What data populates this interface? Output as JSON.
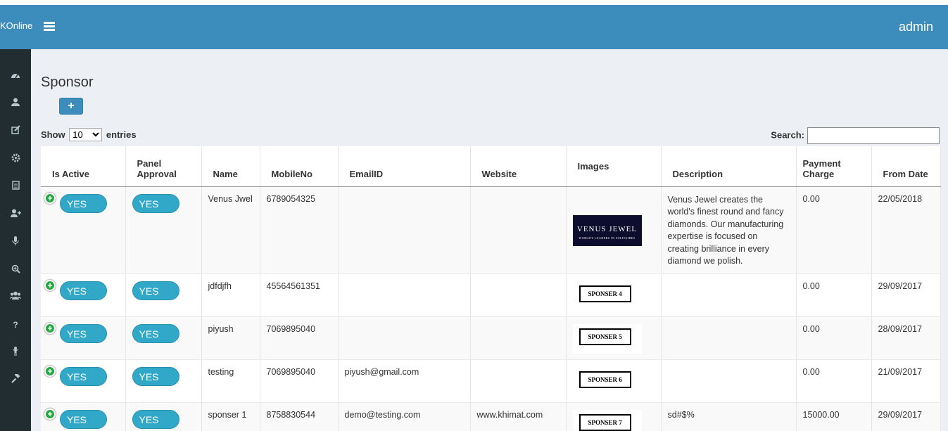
{
  "app": {
    "brand": "KOnline",
    "user": "admin"
  },
  "page": {
    "title": "Sponsor",
    "add_label": "+"
  },
  "table_controls": {
    "show_label": "Show",
    "entries_value": "10",
    "entries_label": "entries",
    "search_label": "Search:"
  },
  "columns": [
    "Is Active",
    "Panel Approval",
    "Name",
    "MobileNo",
    "EmailID",
    "Website",
    "Images",
    "Description",
    "Payment Charge",
    "From Date"
  ],
  "rows": [
    {
      "active": "YES",
      "approval": "YES",
      "name": "Venus Jwel",
      "mobile": "6789054325",
      "email": "",
      "website": "",
      "image": "VENUS JEWEL",
      "image_sub": "WORLD'S LEADERS IN SOLITAIRES",
      "description": "Venus Jewel creates the world's finest round and fancy diamonds. Our manufacturing expertise is focused on creating brilliance in every diamond we polish.",
      "payment": "0.00",
      "from": "22/05/2018"
    },
    {
      "active": "YES",
      "approval": "YES",
      "name": "jdfdjfh",
      "mobile": "45564561351",
      "email": "",
      "website": "",
      "image": "SPONSER 4",
      "description": "",
      "payment": "0.00",
      "from": "29/09/2017"
    },
    {
      "active": "YES",
      "approval": "YES",
      "name": "piyush",
      "mobile": "7069895040",
      "email": "",
      "website": "",
      "image": "SPONSER 5",
      "description": "",
      "payment": "0.00",
      "from": "28/09/2017"
    },
    {
      "active": "YES",
      "approval": "YES",
      "name": "testing",
      "mobile": "7069895040",
      "email": "piyush@gmail.com",
      "website": "",
      "image": "SPONSER 6",
      "description": "",
      "payment": "0.00",
      "from": "21/09/2017"
    },
    {
      "active": "YES",
      "approval": "YES",
      "name": "sponser 1",
      "mobile": "8758830544",
      "email": "demo@testing.com",
      "website": "www.khimat.com",
      "image": "SPONSER 7",
      "description": "sd#$%",
      "payment": "15000.00",
      "from": "29/09/2017"
    }
  ],
  "sidebar_icons": [
    "dashboard-icon",
    "user-icon",
    "edit-icon",
    "settings-icon",
    "document-icon",
    "add-user-icon",
    "microphone-icon",
    "search-plus-icon",
    "users-icon",
    "question-icon",
    "child-icon",
    "gavel-icon"
  ],
  "colors": {
    "header": "#3c8dbc",
    "sidebar": "#222d32",
    "pill": "#31a8c7",
    "plus": "#28a745"
  }
}
